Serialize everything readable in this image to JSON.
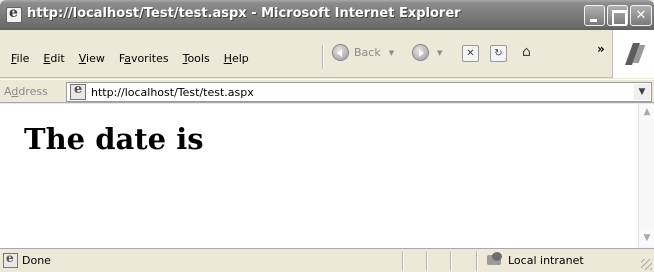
{
  "window": {
    "title": "http://localhost/Test/test.aspx - Microsoft Internet Explorer"
  },
  "menu": {
    "items": [
      {
        "accel": "F",
        "rest": "ile"
      },
      {
        "accel": "E",
        "rest": "dit"
      },
      {
        "accel": "V",
        "rest": "iew",
        "prefix": ""
      },
      {
        "prefix": "F",
        "accel": "a",
        "rest": "vorites"
      },
      {
        "accel": "T",
        "rest": "ools"
      },
      {
        "accel": "H",
        "rest": "elp"
      }
    ]
  },
  "toolbar": {
    "back_label": "Back",
    "overflow": "»"
  },
  "address": {
    "label_accel": "d",
    "label_prefix": "A",
    "label_rest": "dress",
    "url": "http://localhost/Test/test.aspx"
  },
  "content": {
    "heading": "The date is"
  },
  "status": {
    "text": "Done",
    "zone": "Local intranet"
  },
  "icons": {
    "app": "ie-logo-icon",
    "back": "back-arrow-icon",
    "forward": "forward-arrow-icon",
    "stop": "stop-icon",
    "refresh": "refresh-icon",
    "home": "home-icon",
    "throbber": "windows-logo-icon",
    "page": "page-icon",
    "zone": "local-intranet-icon"
  }
}
